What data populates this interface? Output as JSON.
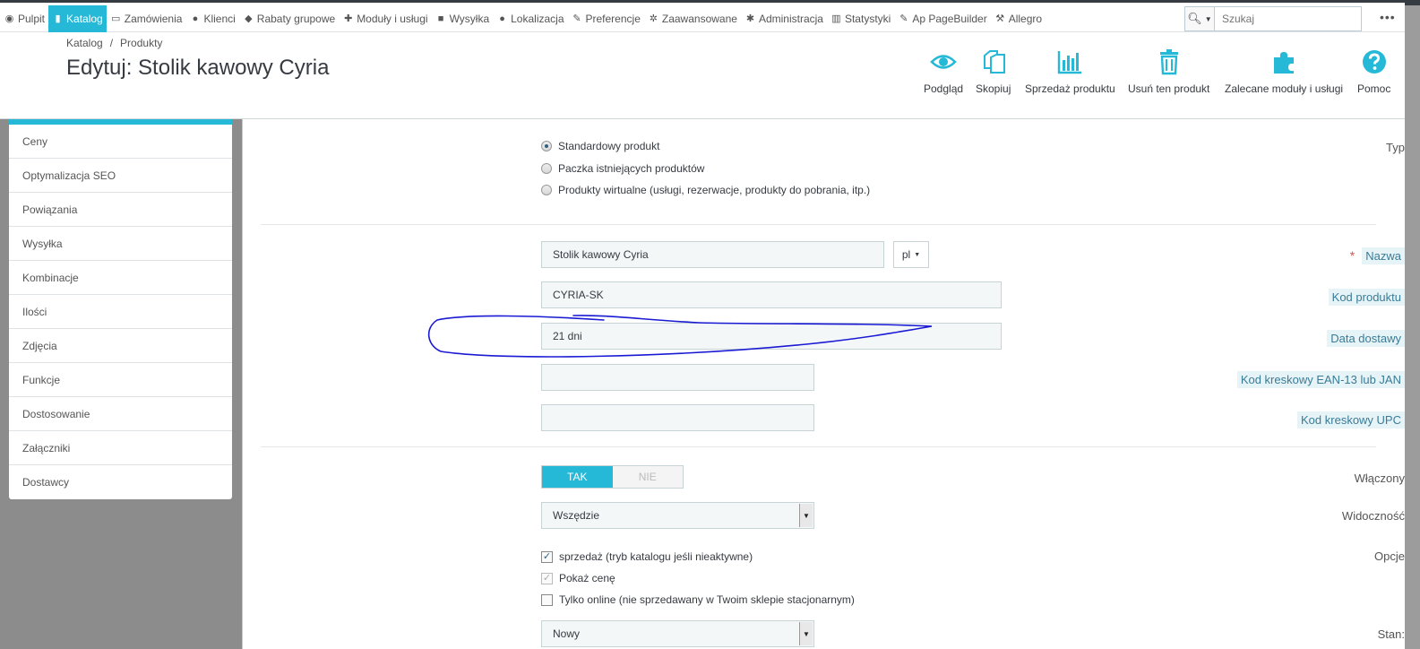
{
  "nav": {
    "items": [
      {
        "label": "Pulpit",
        "icon": "dashboard-icon"
      },
      {
        "label": "Katalog",
        "icon": "book-icon",
        "active": true
      },
      {
        "label": "Zamówienia",
        "icon": "credit-card-icon"
      },
      {
        "label": "Klienci",
        "icon": "users-icon"
      },
      {
        "label": "Rabaty grupowe",
        "icon": "tag-icon"
      },
      {
        "label": "Moduły i usługi",
        "icon": "puzzle-icon"
      },
      {
        "label": "Wysyłka",
        "icon": "truck-icon"
      },
      {
        "label": "Lokalizacja",
        "icon": "globe-icon"
      },
      {
        "label": "Preferencje",
        "icon": "wrench-icon"
      },
      {
        "label": "Zaawansowane",
        "icon": "cogs-icon"
      },
      {
        "label": "Administracja",
        "icon": "gear-icon"
      },
      {
        "label": "Statystyki",
        "icon": "bar-chart-icon"
      },
      {
        "label": "Ap PageBuilder",
        "icon": "edit-icon"
      },
      {
        "label": "Allegro",
        "icon": "gavel-icon"
      }
    ],
    "search_placeholder": "Szukaj",
    "more": "•••"
  },
  "header": {
    "breadcrumb": [
      "Katalog",
      "Produkty"
    ],
    "breadcrumb_sep": "/",
    "title": "Edytuj: Stolik kawowy Cyria",
    "toolbar": [
      {
        "label": "Podgląd",
        "icon": "eye-icon"
      },
      {
        "label": "Skopiuj",
        "icon": "copy-icon"
      },
      {
        "label": "Sprzedaż produktu",
        "icon": "bar-chart-icon"
      },
      {
        "label": "Usuń ten produkt",
        "icon": "trash-icon"
      },
      {
        "label": "Zalecane moduły i usługi",
        "icon": "puzzle-icon"
      },
      {
        "label": "Pomoc",
        "icon": "help-icon"
      }
    ],
    "accent_color": "#25b9d7"
  },
  "sidebar": {
    "items": [
      {
        "label": "Ceny"
      },
      {
        "label": "Optymalizacja SEO"
      },
      {
        "label": "Powiązania"
      },
      {
        "label": "Wysyłka"
      },
      {
        "label": "Kombinacje"
      },
      {
        "label": "Ilości"
      },
      {
        "label": "Zdjęcia"
      },
      {
        "label": "Funkcje"
      },
      {
        "label": "Dostosowanie"
      },
      {
        "label": "Załączniki"
      },
      {
        "label": "Dostawcy"
      }
    ]
  },
  "form": {
    "type": {
      "label": "Typ",
      "options": [
        {
          "label": "Standardowy produkt",
          "checked": true
        },
        {
          "label": "Paczka istniejących produktów",
          "checked": false
        },
        {
          "label": "Produkty wirtualne (usługi, rezerwacje, produkty do pobrania, itp.)",
          "checked": false
        }
      ]
    },
    "name": {
      "label": "Nazwa",
      "required_mark": "*",
      "value": "Stolik kawowy Cyria",
      "lang": "pl"
    },
    "reference": {
      "label": "Kod produktu",
      "value": "CYRIA-SK"
    },
    "delivery": {
      "label": "Data dostawy",
      "value": "21 dni"
    },
    "ean13": {
      "label": "Kod kreskowy EAN-13 lub JAN",
      "value": ""
    },
    "upc": {
      "label": "Kod kreskowy UPC",
      "value": ""
    },
    "enabled": {
      "label": "Włączony",
      "on": "TAK",
      "off": "NIE",
      "value": "TAK"
    },
    "visibility": {
      "label": "Widoczność",
      "value": "Wszędzie"
    },
    "options": {
      "label": "Opcje",
      "items": [
        {
          "label": "sprzedaż (tryb katalogu jeśli nieaktywne)",
          "checked": true
        },
        {
          "label": "Pokaż cenę",
          "checked": true,
          "disabled": true
        },
        {
          "label": "Tylko online (nie sprzedawany w Twoim sklepie stacjonarnym)",
          "checked": false
        }
      ]
    },
    "condition": {
      "label": "Stan:",
      "value": "Nowy"
    }
  }
}
